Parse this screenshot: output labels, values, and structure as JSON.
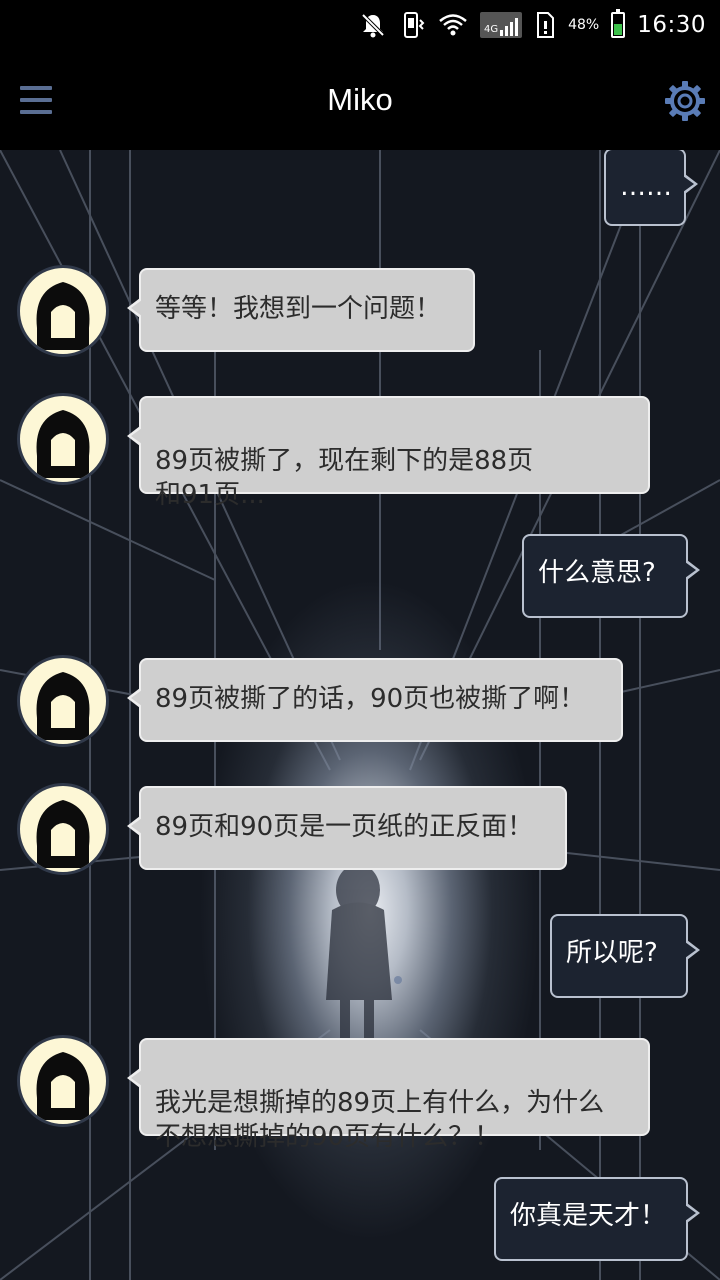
{
  "status_bar": {
    "network_type": "4G",
    "battery_percent": "48%",
    "battery_level": 0.48,
    "time": "16:30",
    "icons": [
      "notification-muted-icon",
      "vibrate-icon",
      "wifi-icon",
      "signal-icon",
      "sim-alert-icon",
      "battery-icon"
    ]
  },
  "app_bar": {
    "title": "Miko",
    "menu_icon": "hamburger-menu-icon",
    "settings_icon": "gear-icon"
  },
  "messages": [
    {
      "side": "right",
      "text": "……"
    },
    {
      "side": "left",
      "text": "等等！我想到一个问题！"
    },
    {
      "side": "left",
      "text": "89页被撕了，现在剩下的是88页\n和91页..."
    },
    {
      "side": "right",
      "text": "什么意思?"
    },
    {
      "side": "left",
      "text": "89页被撕了的话，90页也被撕了啊！"
    },
    {
      "side": "left",
      "text": "89页和90页是一页纸的正反面！"
    },
    {
      "side": "right",
      "text": "所以呢?"
    },
    {
      "side": "left",
      "text": "我光是想撕掉的89页上有什么，为什么\n不想想撕掉的90页有什么？！"
    },
    {
      "side": "right",
      "text": "你真是天才！"
    }
  ],
  "colors": {
    "left_bubble_bg": "#cfcfcf",
    "right_bubble_bg": "#1c2330",
    "right_bubble_border": "#b9c1cf",
    "avatar_bg": "#fdf7d6",
    "menu_icon": "#5a6e93",
    "battery_fill": "#3cc04a"
  }
}
